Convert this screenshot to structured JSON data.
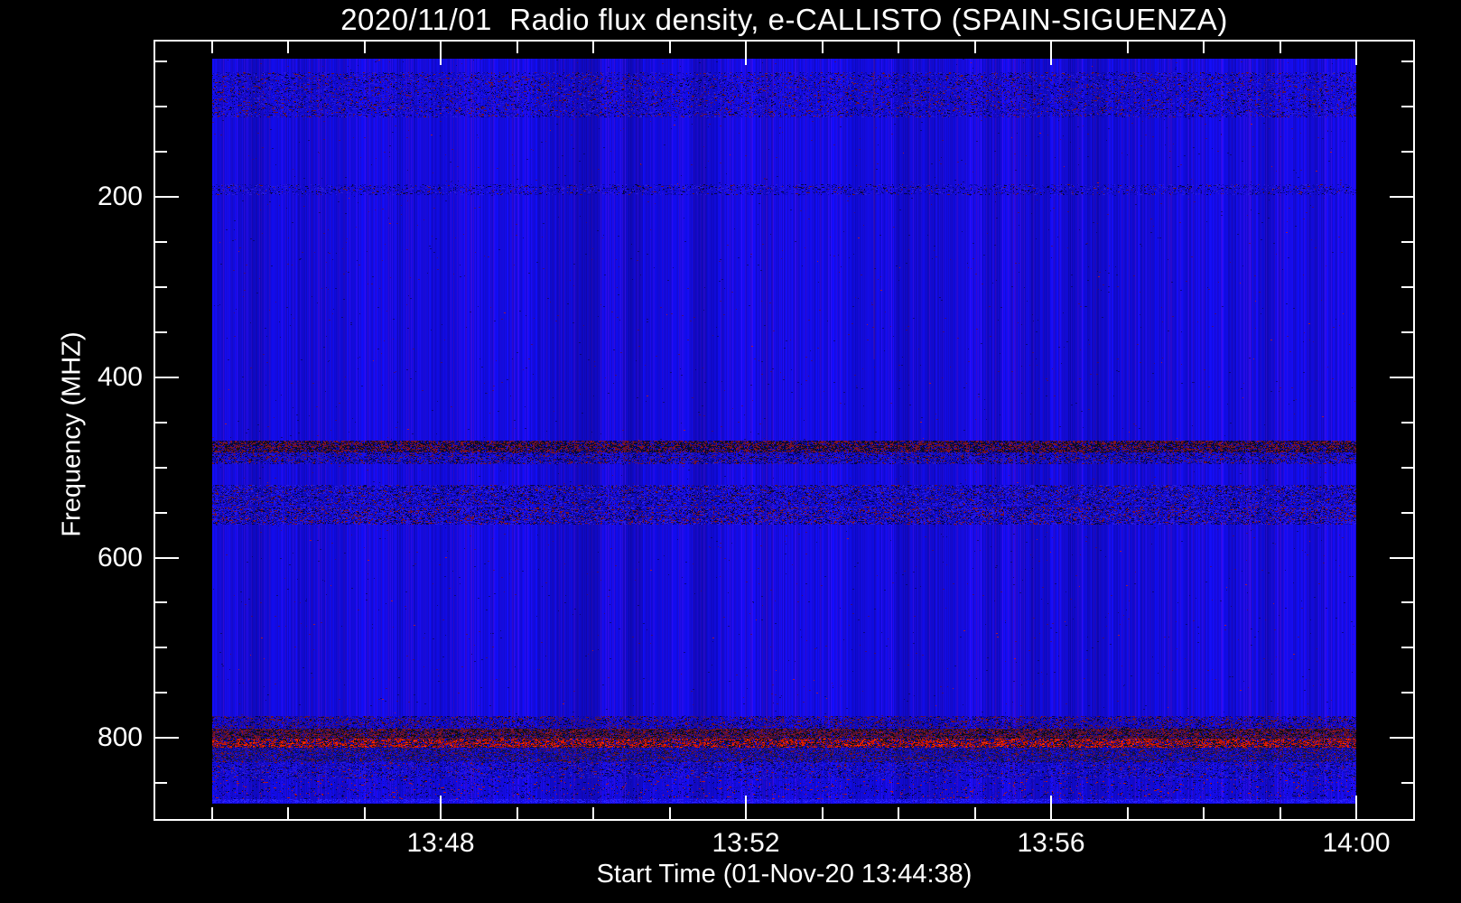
{
  "chart_data": {
    "type": "heatmap",
    "subtype": "radio-spectrogram",
    "title": "2020/11/01  Radio flux density, e-CALLISTO (SPAIN-SIGUENZA)",
    "xlabel": "Start Time (01-Nov-20 13:44:38)",
    "ylabel": "Frequency (MHZ)",
    "x_axis": {
      "start_time": "13:44:38",
      "end_time": "14:00:00",
      "major_ticks": [
        {
          "label": "13:48",
          "minute": 48
        },
        {
          "label": "13:52",
          "minute": 52
        },
        {
          "label": "13:56",
          "minute": 56
        },
        {
          "label": "14:00",
          "minute": 60
        }
      ],
      "minor_tick_minutes": [
        45,
        46,
        47,
        49,
        50,
        51,
        53,
        54,
        55,
        57,
        58,
        59
      ]
    },
    "y_axis": {
      "unit": "MHZ",
      "direction": "increasing-downward",
      "top_mhz": 47,
      "bottom_mhz": 873,
      "major_ticks": [
        {
          "label": "200",
          "mhz": 200
        },
        {
          "label": "400",
          "mhz": 400
        },
        {
          "label": "600",
          "mhz": 600
        },
        {
          "label": "800",
          "mhz": 800
        }
      ],
      "minor_tick_mhz": [
        50,
        100,
        150,
        250,
        300,
        350,
        450,
        500,
        550,
        650,
        700,
        750,
        850
      ]
    },
    "colors": {
      "background": "#000000",
      "axes_text": "#ffffff",
      "quiet_sky_blue": "#1511ea",
      "rfi_bright_red": "#d81800",
      "rfi_dark_red": "#7a1228",
      "rfi_dark_navy": "#06053c"
    },
    "quiet_background": "uniform blue with faint vertical striping and sparse speckles",
    "vertical_streak": {
      "minute": 53.67,
      "freq_lo_mhz": 47,
      "freq_hi_mhz": 380
    },
    "speckle_count": 2600,
    "rfi_bands": [
      {
        "freq_lo": 62,
        "freq_hi": 112,
        "density": 0.3,
        "palette": [
          {
            "c": "#0c09b0",
            "w": 5
          },
          {
            "c": "#060540",
            "w": 2
          },
          {
            "c": "#6e1226",
            "w": 2
          },
          {
            "c": "#2a1cd8",
            "w": 3
          }
        ]
      },
      {
        "freq_lo": 186,
        "freq_hi": 198,
        "density": 0.25,
        "palette": [
          {
            "c": "#0c09b0",
            "w": 5
          },
          {
            "c": "#060540",
            "w": 2
          },
          {
            "c": "#63122a",
            "w": 1
          },
          {
            "c": "#2a1cd8",
            "w": 3
          }
        ]
      },
      {
        "freq_lo": 470,
        "freq_hi": 483,
        "density": 0.88,
        "palette": [
          {
            "c": "#05053a",
            "w": 3
          },
          {
            "c": "#101018",
            "w": 2
          },
          {
            "c": "#801326",
            "w": 3
          },
          {
            "c": "#5c0f2c",
            "w": 2
          },
          {
            "c": "#0c09a0",
            "w": 2
          }
        ]
      },
      {
        "freq_lo": 483,
        "freq_hi": 496,
        "density": 0.6,
        "palette": [
          {
            "c": "#0a08a0",
            "w": 4
          },
          {
            "c": "#060540",
            "w": 2
          },
          {
            "c": "#70122a",
            "w": 2
          },
          {
            "c": "#2218c8",
            "w": 3
          }
        ]
      },
      {
        "freq_lo": 519,
        "freq_hi": 542,
        "density": 0.55,
        "palette": [
          {
            "c": "#0b09ae",
            "w": 5
          },
          {
            "c": "#060545",
            "w": 2
          },
          {
            "c": "#661226",
            "w": 1.5
          },
          {
            "c": "#2a1ce0",
            "w": 3
          }
        ]
      },
      {
        "freq_lo": 543,
        "freq_hi": 563,
        "density": 0.62,
        "palette": [
          {
            "c": "#0b09ae",
            "w": 4
          },
          {
            "c": "#060545",
            "w": 2
          },
          {
            "c": "#78122a",
            "w": 2
          },
          {
            "c": "#2a1ce0",
            "w": 3
          }
        ]
      },
      {
        "freq_lo": 776,
        "freq_hi": 790,
        "density": 0.5,
        "palette": [
          {
            "c": "#0b08a8",
            "w": 4
          },
          {
            "c": "#3a1370",
            "w": 2
          },
          {
            "c": "#6e1226",
            "w": 2
          },
          {
            "c": "#060540",
            "w": 2
          }
        ]
      },
      {
        "freq_lo": 790,
        "freq_hi": 801,
        "density": 0.9,
        "palette": [
          {
            "c": "#0d0d16",
            "w": 3
          },
          {
            "c": "#5c1030",
            "w": 3
          },
          {
            "c": "#8c1420",
            "w": 2
          },
          {
            "c": "#35104e",
            "w": 2
          },
          {
            "c": "#0a0880",
            "w": 1
          }
        ]
      },
      {
        "freq_lo": 801,
        "freq_hi": 811,
        "density": 0.88,
        "palette": [
          {
            "c": "#d81800",
            "w": 3
          },
          {
            "c": "#ff3000",
            "w": 0.6
          },
          {
            "c": "#a01510",
            "w": 2
          },
          {
            "c": "#101014",
            "w": 2
          },
          {
            "c": "#5c1030",
            "w": 2
          },
          {
            "c": "#0a088c",
            "w": 2
          }
        ]
      },
      {
        "freq_lo": 811,
        "freq_hi": 827,
        "density": 0.7,
        "palette": [
          {
            "c": "#0a0890",
            "w": 3
          },
          {
            "c": "#2c1468",
            "w": 2
          },
          {
            "c": "#101040",
            "w": 2
          },
          {
            "c": "#70122a",
            "w": 1.5
          },
          {
            "c": "#1814c0",
            "w": 2
          }
        ]
      },
      {
        "freq_lo": 827,
        "freq_hi": 845,
        "density": 0.45,
        "palette": [
          {
            "c": "#0c0ab4",
            "w": 5
          },
          {
            "c": "#060548",
            "w": 2
          },
          {
            "c": "#80122a",
            "w": 1
          },
          {
            "c": "#2a1cd8",
            "w": 3
          }
        ]
      },
      {
        "freq_lo": 846,
        "freq_hi": 868,
        "density": 0.18,
        "palette": [
          {
            "c": "#100cc0",
            "w": 6
          },
          {
            "c": "#b01818",
            "w": 1
          },
          {
            "c": "#060548",
            "w": 2
          }
        ]
      },
      {
        "freq_lo": 868,
        "freq_hi": 872,
        "density": 0.5,
        "palette": [
          {
            "c": "#2b22ff",
            "w": 3
          },
          {
            "c": "#1a14e8",
            "w": 2
          }
        ]
      }
    ]
  }
}
